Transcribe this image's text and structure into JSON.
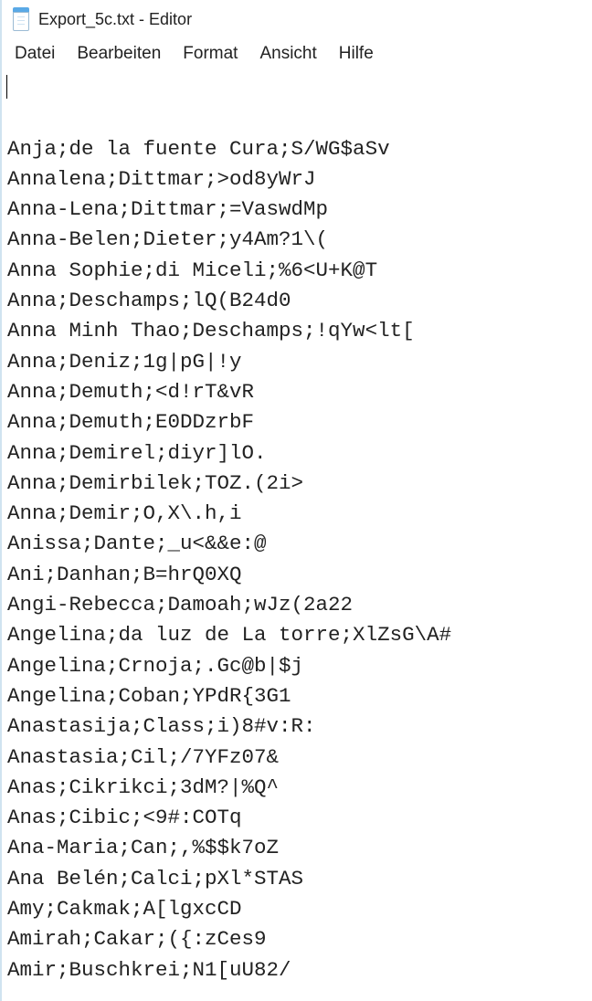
{
  "window": {
    "title": "Export_5c.txt - Editor"
  },
  "menu": {
    "items": [
      "Datei",
      "Bearbeiten",
      "Format",
      "Ansicht",
      "Hilfe"
    ]
  },
  "content_lines": [
    "Anja;de la fuente Cura;S/WG$aSv",
    "Annalena;Dittmar;>od8yWrJ",
    "Anna-Lena;Dittmar;=VaswdMp",
    "Anna-Belen;Dieter;y4Am?1\\(",
    "Anna Sophie;di Miceli;%6<U+K@T",
    "Anna;Deschamps;lQ(B24d0",
    "Anna Minh Thao;Deschamps;!qYw<lt[",
    "Anna;Deniz;1g|pG|!y",
    "Anna;Demuth;<d!rT&vR",
    "Anna;Demuth;E0DDzrbF",
    "Anna;Demirel;diyr]lO.",
    "Anna;Demirbilek;TOZ.(2i>",
    "Anna;Demir;O,X\\.h,i",
    "Anissa;Dante;_u<&&e:@",
    "Ani;Danhan;B=hrQ0XQ",
    "Angi-Rebecca;Damoah;wJz(2a22",
    "Angelina;da luz de La torre;XlZsG\\A#",
    "Angelina;Crnoja;.Gc@b|$j",
    "Angelina;Coban;YPdR{3G1",
    "Anastasija;Class;i)8#v:R:",
    "Anastasia;Cil;/7YFz07&",
    "Anas;Cikrikci;3dM?|%Q^",
    "Anas;Cibic;<9#:COTq",
    "Ana-Maria;Can;,%$$k7oZ",
    "Ana Belén;Calci;pXl*STAS",
    "Amy;Cakmak;A[lgxcCD",
    "Amirah;Cakar;({:zCes9",
    "Amir;Buschkrei;N1[uU82/"
  ]
}
